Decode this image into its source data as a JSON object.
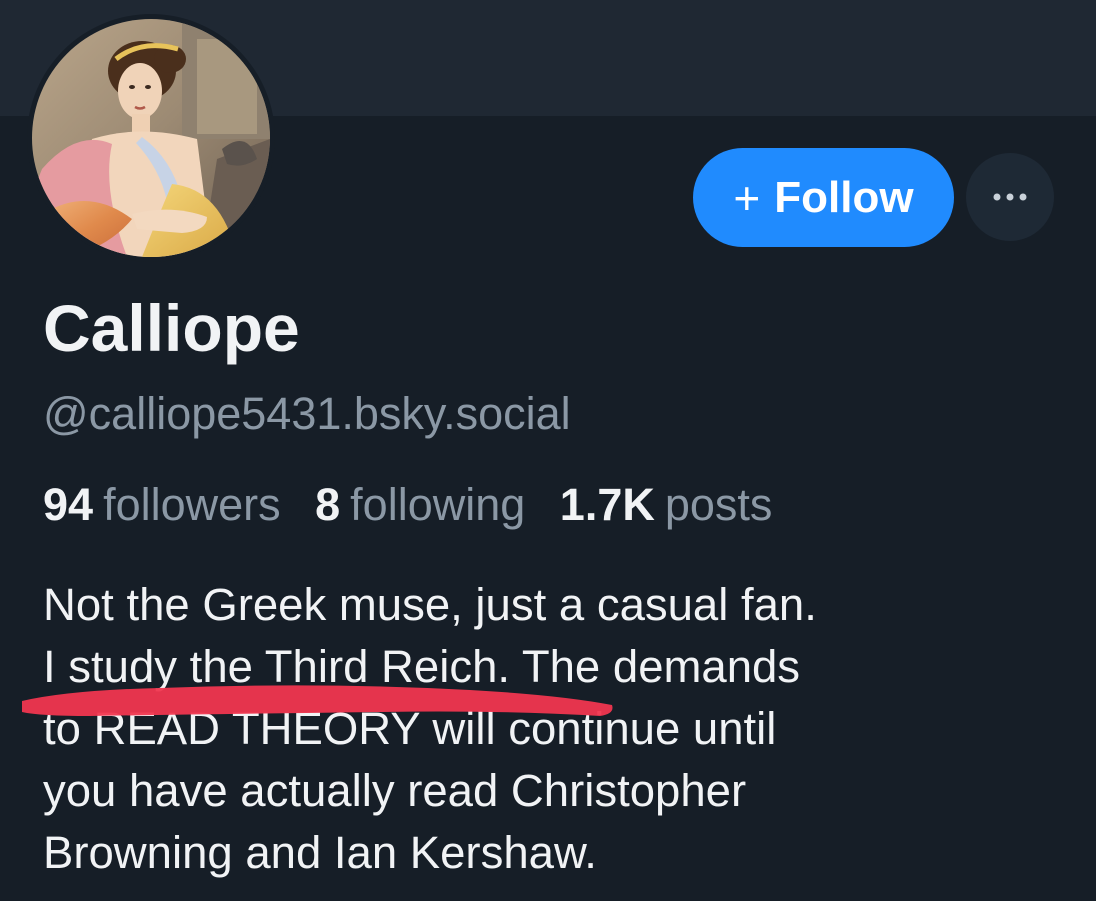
{
  "profile": {
    "display_name": "Calliope",
    "handle": "@calliope5431.bsky.social",
    "avatar_icon": "classical-painting-portrait"
  },
  "actions": {
    "follow_icon": "+",
    "follow_label": "Follow",
    "more_icon": "ellipsis-icon"
  },
  "stats": {
    "followers_count": "94",
    "followers_label": "followers",
    "following_count": "8",
    "following_label": "following",
    "posts_count": "1.7K",
    "posts_label": "posts"
  },
  "bio": {
    "lines": [
      "Not the Greek muse, just a casual fan.",
      "I study the Third Reich. The demands",
      "to READ THEORY will continue until",
      "you have actually read Christopher",
      "Browning and Ian Kershaw."
    ]
  },
  "colors": {
    "background": "#161e27",
    "banner": "#1f2833",
    "accent": "#208bfe",
    "text_primary": "#f1f3f5",
    "text_secondary": "#8b98a5",
    "annotation": "#f0364f"
  }
}
